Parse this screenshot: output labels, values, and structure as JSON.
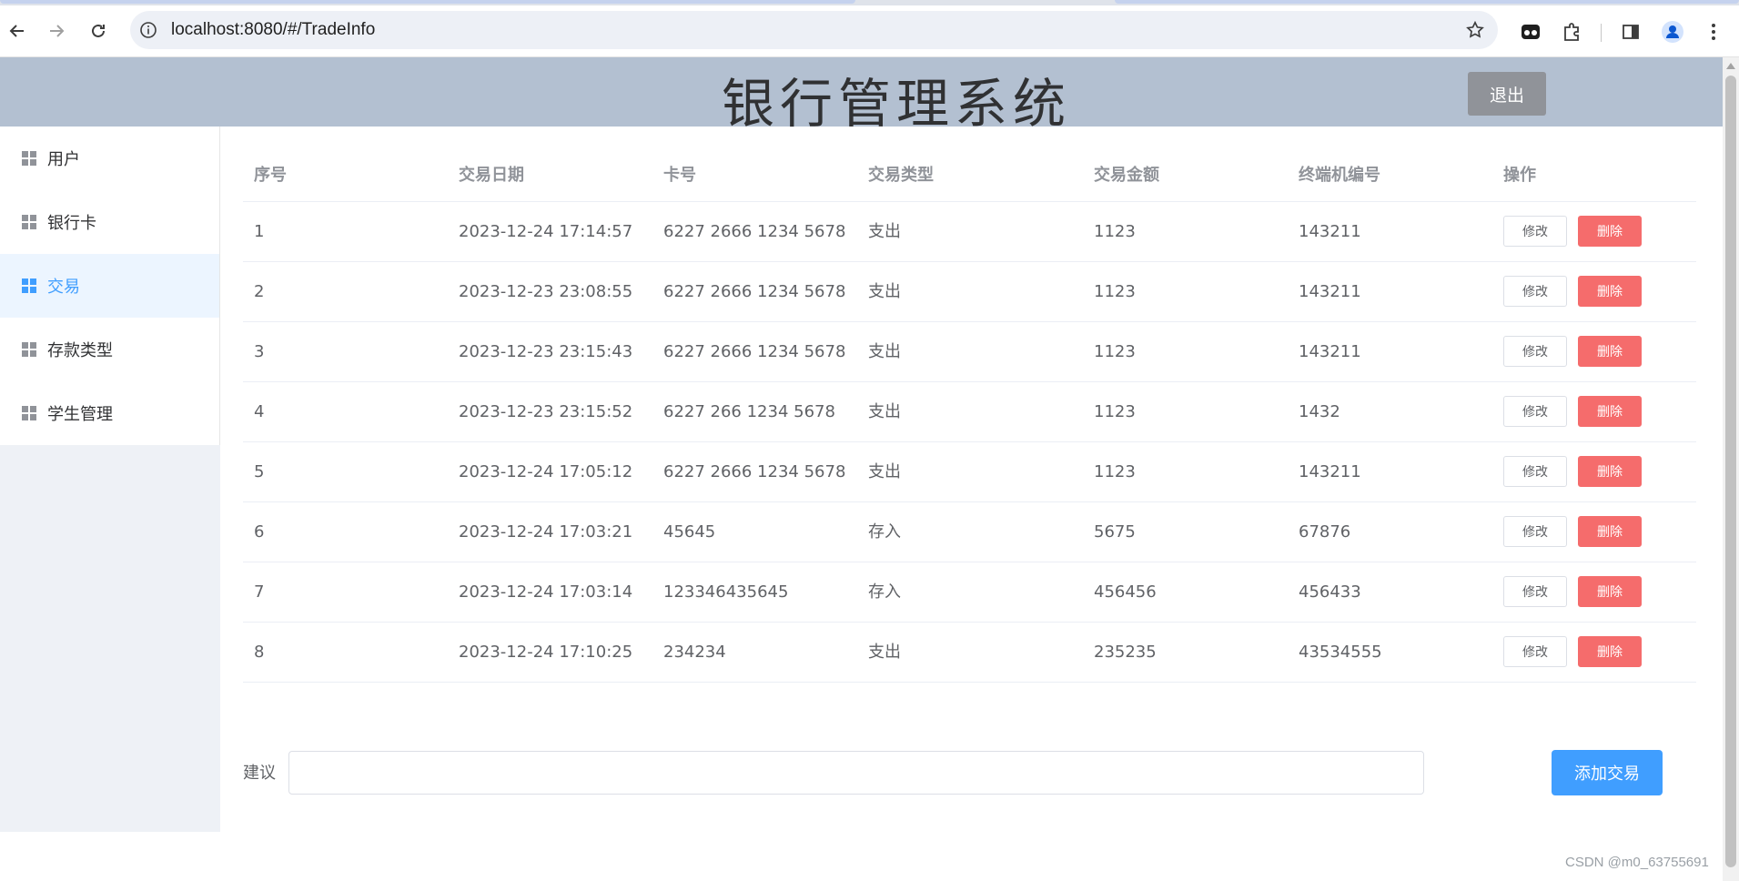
{
  "browser": {
    "url": "localhost:8080/#/TradeInfo"
  },
  "header": {
    "title": "银行管理系统",
    "logout_label": "退出"
  },
  "sidebar": {
    "items": [
      {
        "label": "用户",
        "active": false
      },
      {
        "label": "银行卡",
        "active": false
      },
      {
        "label": "交易",
        "active": true
      },
      {
        "label": "存款类型",
        "active": false
      },
      {
        "label": "学生管理",
        "active": false
      }
    ]
  },
  "table": {
    "columns": [
      "序号",
      "交易日期",
      "卡号",
      "交易类型",
      "交易金额",
      "终端机编号",
      "操作"
    ],
    "edit_label": "修改",
    "delete_label": "删除",
    "rows": [
      [
        "1",
        "2023-12-24 17:14:57",
        "6227 2666 1234 5678",
        "支出",
        "1123",
        "143211"
      ],
      [
        "2",
        "2023-12-23 23:08:55",
        "6227 2666 1234 5678",
        "支出",
        "1123",
        "143211"
      ],
      [
        "3",
        "2023-12-23 23:15:43",
        "6227 2666 1234 5678",
        "支出",
        "1123",
        "143211"
      ],
      [
        "4",
        "2023-12-23 23:15:52",
        "6227 266 1234 5678",
        "支出",
        "1123",
        "1432"
      ],
      [
        "5",
        "2023-12-24 17:05:12",
        "6227 2666 1234 5678",
        "支出",
        "1123",
        "143211"
      ],
      [
        "6",
        "2023-12-24 17:03:21",
        "45645",
        "存入",
        "5675",
        "67876"
      ],
      [
        "7",
        "2023-12-24 17:03:14",
        "123346435645",
        "存入",
        "456456",
        "456433"
      ],
      [
        "8",
        "2023-12-24 17:10:25",
        "234234",
        "支出",
        "235235",
        "43534555"
      ]
    ]
  },
  "suggestion": {
    "label": "建议",
    "value": "",
    "add_button_label": "添加交易"
  },
  "watermark": "CSDN @m0_63755691",
  "colors": {
    "header_bg": "#b3c0d1",
    "sidebar_bg": "#eef1f6",
    "primary": "#409eff",
    "danger": "#f56c6c",
    "info": "#909399"
  }
}
